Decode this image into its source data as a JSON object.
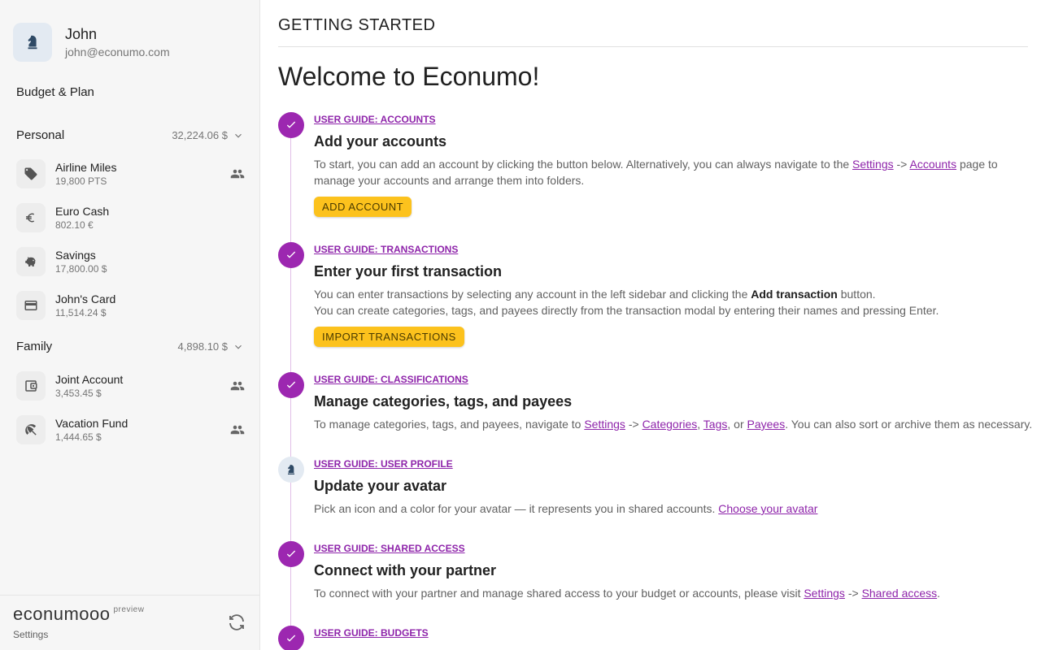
{
  "user": {
    "name": "John",
    "email": "john@econumo.com"
  },
  "nav": {
    "budget_plan": "Budget & Plan"
  },
  "folders": [
    {
      "name": "Personal",
      "total": "32,224.06 $",
      "accounts": [
        {
          "name": "Airline Miles",
          "balance": "19,800 PTS",
          "icon": "tag-icon",
          "shared": true
        },
        {
          "name": "Euro Cash",
          "balance": "802.10 €",
          "icon": "euro-icon",
          "shared": false
        },
        {
          "name": "Savings",
          "balance": "17,800.00 $",
          "icon": "piggy-bank-icon",
          "shared": false
        },
        {
          "name": "John's Card",
          "balance": "11,514.24 $",
          "icon": "credit-card-icon",
          "shared": false
        }
      ]
    },
    {
      "name": "Family",
      "total": "4,898.10 $",
      "accounts": [
        {
          "name": "Joint Account",
          "balance": "3,453.45 $",
          "icon": "wallet-icon",
          "shared": true
        },
        {
          "name": "Vacation Fund",
          "balance": "1,444.65 $",
          "icon": "beach-umbrella-icon",
          "shared": true
        }
      ]
    }
  ],
  "footer": {
    "logo": "econumooo",
    "preview": "preview",
    "settings": "Settings"
  },
  "page": {
    "header": "GETTING STARTED",
    "welcome": "Welcome to Econumo!"
  },
  "steps": [
    {
      "link": "USER GUIDE: ACCOUNTS",
      "title": "Add your accounts",
      "desc_1": "To start, you can add an account by clicking the button below. Alternatively, you can always navigate to the ",
      "link_settings": "Settings",
      "arrow": " -> ",
      "link_accounts": "Accounts",
      "desc_2": " page to manage your accounts and arrange them into folders.",
      "button": "ADD ACCOUNT",
      "done": true
    },
    {
      "link": "USER GUIDE: TRANSACTIONS",
      "title": "Enter your first transaction",
      "desc_1": "You can enter transactions by selecting any account in the left sidebar and clicking the ",
      "bold": "Add transaction",
      "desc_2": " button.",
      "desc_3": "You can create categories, tags, and payees directly from the transaction modal by entering their names and pressing Enter.",
      "button": "IMPORT TRANSACTIONS",
      "done": true
    },
    {
      "link": "USER GUIDE: CLASSIFICATIONS",
      "title": "Manage categories, tags, and payees",
      "desc_1": "To manage categories, tags, and payees, navigate to ",
      "link_settings": "Settings",
      "arrow": " -> ",
      "link_categories": "Categories",
      "comma": ", ",
      "link_tags": "Tags",
      "or": ", or ",
      "link_payees": "Payees",
      "desc_2": ". You can also sort or archive them as necessary.",
      "done": true
    },
    {
      "link": "USER GUIDE: USER PROFILE",
      "title": "Update your avatar",
      "desc_1": "Pick an icon and a color for your avatar — it represents you in shared accounts. ",
      "link_avatar": "Choose your avatar",
      "done": false
    },
    {
      "link": "USER GUIDE: SHARED ACCESS",
      "title": "Connect with your partner",
      "desc_1": "To connect with your partner and manage shared access to your budget or accounts, please visit ",
      "link_settings": "Settings",
      "arrow": " -> ",
      "link_shared": "Shared access",
      "desc_2": ".",
      "done": true
    },
    {
      "link": "USER GUIDE: BUDGETS",
      "done": true
    }
  ],
  "colors": {
    "accent": "#9c27b0",
    "button": "#fcc21d",
    "line": "#e1bee7"
  }
}
